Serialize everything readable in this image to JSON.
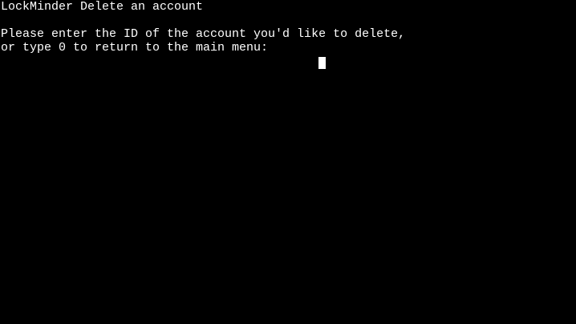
{
  "terminal": {
    "title": "LockMinder Delete an account",
    "prompt_line1": "Please enter the ID of the account you'd like to delete,",
    "prompt_line2": "or type 0 to return to the main menu: ",
    "input_value": "",
    "background_color": "#000000",
    "text_color": "#ffffff",
    "cursor_style": "block"
  }
}
